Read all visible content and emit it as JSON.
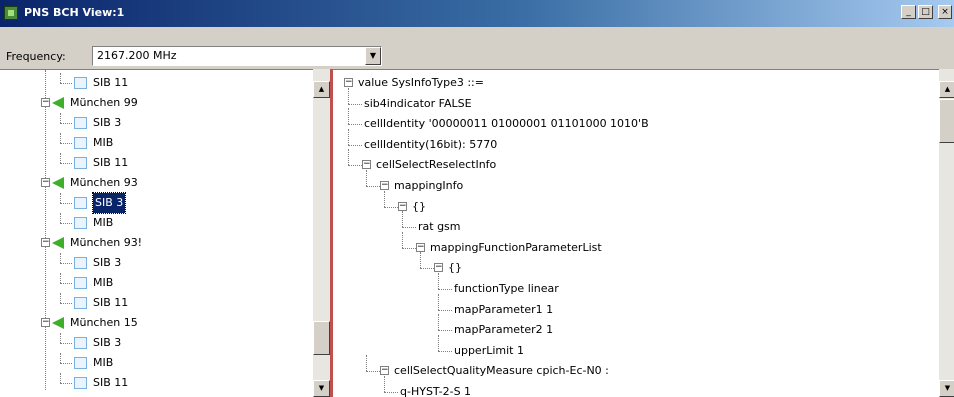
{
  "window": {
    "title": "PNS BCH View:1",
    "minimize": "_",
    "maximize": "□",
    "close": "×"
  },
  "toolbar": {
    "frequency_label": "Frequency:",
    "frequency_value": "2167.200 MHz"
  },
  "left_tree": [
    {
      "type": "child",
      "label": "SIB 11"
    },
    {
      "type": "parent",
      "label": "München 99"
    },
    {
      "type": "child",
      "label": "SIB 3"
    },
    {
      "type": "child",
      "label": "MIB"
    },
    {
      "type": "child",
      "label": "SIB 11"
    },
    {
      "type": "parent",
      "label": "München 93"
    },
    {
      "type": "child",
      "label": "SIB 3",
      "selected": true
    },
    {
      "type": "child",
      "label": "MIB"
    },
    {
      "type": "parent",
      "label": "München 93!"
    },
    {
      "type": "child",
      "label": "SIB 3"
    },
    {
      "type": "child",
      "label": "MIB"
    },
    {
      "type": "child",
      "label": "SIB 11"
    },
    {
      "type": "parent",
      "label": "München 15"
    },
    {
      "type": "child",
      "label": "SIB 3"
    },
    {
      "type": "child",
      "label": "MIB"
    },
    {
      "type": "child",
      "label": "SIB 11"
    }
  ],
  "right_tree": [
    {
      "level": 0,
      "expander": true,
      "label": "value SysInfoType3 ::="
    },
    {
      "level": 1,
      "expander": false,
      "label": "sib4indicator FALSE"
    },
    {
      "level": 1,
      "expander": false,
      "label": "cellIdentity '00000011 01000001 01101000 1010'B"
    },
    {
      "level": 1,
      "expander": false,
      "label": "cellIdentity(16bit): 5770"
    },
    {
      "level": 1,
      "expander": true,
      "label": "cellSelectReselectInfo"
    },
    {
      "level": 2,
      "expander": true,
      "label": "mappingInfo"
    },
    {
      "level": 3,
      "expander": true,
      "label": "{}"
    },
    {
      "level": 4,
      "expander": false,
      "label": "rat gsm"
    },
    {
      "level": 4,
      "expander": true,
      "label": "mappingFunctionParameterList"
    },
    {
      "level": 5,
      "expander": true,
      "label": "{}"
    },
    {
      "level": 6,
      "expander": false,
      "label": "functionType linear"
    },
    {
      "level": 6,
      "expander": false,
      "label": "mapParameter1 1"
    },
    {
      "level": 6,
      "expander": false,
      "label": "mapParameter2 1"
    },
    {
      "level": 6,
      "expander": false,
      "label": "upperLimit 1"
    },
    {
      "level": 2,
      "expander": true,
      "label": "cellSelectQualityMeasure cpich-Ec-N0 :"
    },
    {
      "level": 3,
      "expander": false,
      "label": "q-HYST-2-S 1"
    }
  ]
}
